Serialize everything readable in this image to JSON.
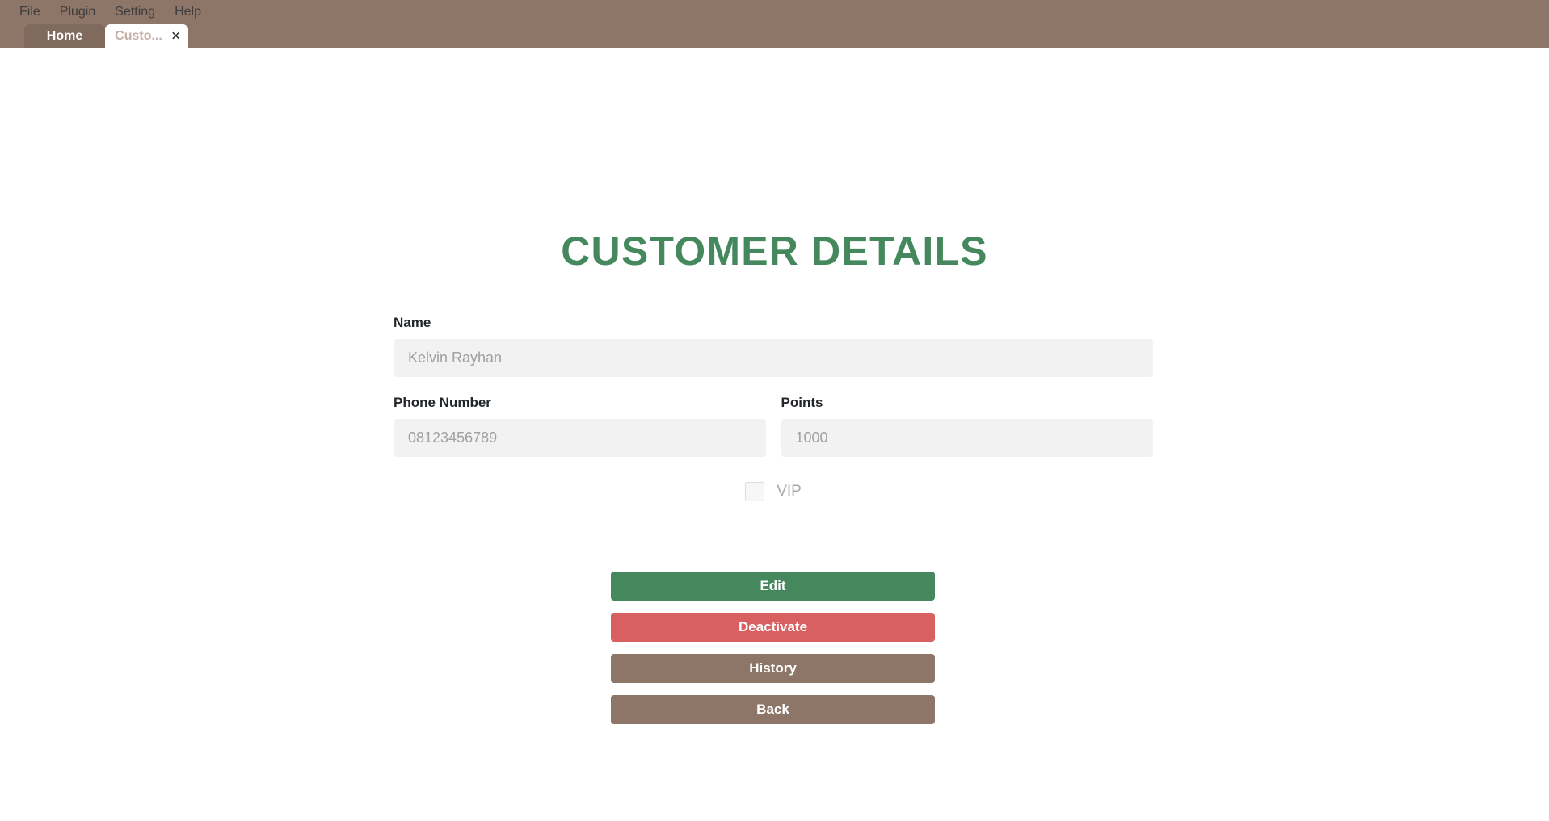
{
  "window": {
    "menubar": [
      {
        "label": "File"
      },
      {
        "label": "Plugin"
      },
      {
        "label": "Setting"
      },
      {
        "label": "Help"
      }
    ],
    "tabs": [
      {
        "label": "Home",
        "active": false
      },
      {
        "label": "Custo...",
        "active": true,
        "close_icon": "close-icon",
        "close_glyph": "✕"
      }
    ]
  },
  "page": {
    "title": "CUSTOMER DETAILS"
  },
  "form": {
    "name": {
      "label": "Name",
      "value": "Kelvin Rayhan",
      "placeholder": "Kelvin Rayhan"
    },
    "phone": {
      "label": "Phone Number",
      "value": "08123456789",
      "placeholder": "08123456789"
    },
    "points": {
      "label": "Points",
      "value": "1000",
      "placeholder": "1000"
    },
    "vip": {
      "label": "VIP",
      "checked": false
    }
  },
  "actions": [
    {
      "label": "Edit"
    },
    {
      "label": "Deactivate"
    },
    {
      "label": "History"
    },
    {
      "label": "Back"
    }
  ],
  "colors": {
    "chrome_brown": "#8d7667",
    "tab_inactive_brown": "#806a5d",
    "accent_green": "#45885e",
    "danger_red": "#d96060",
    "field_gray": "#f2f2f2",
    "muted_text": "#a0a0a0"
  }
}
